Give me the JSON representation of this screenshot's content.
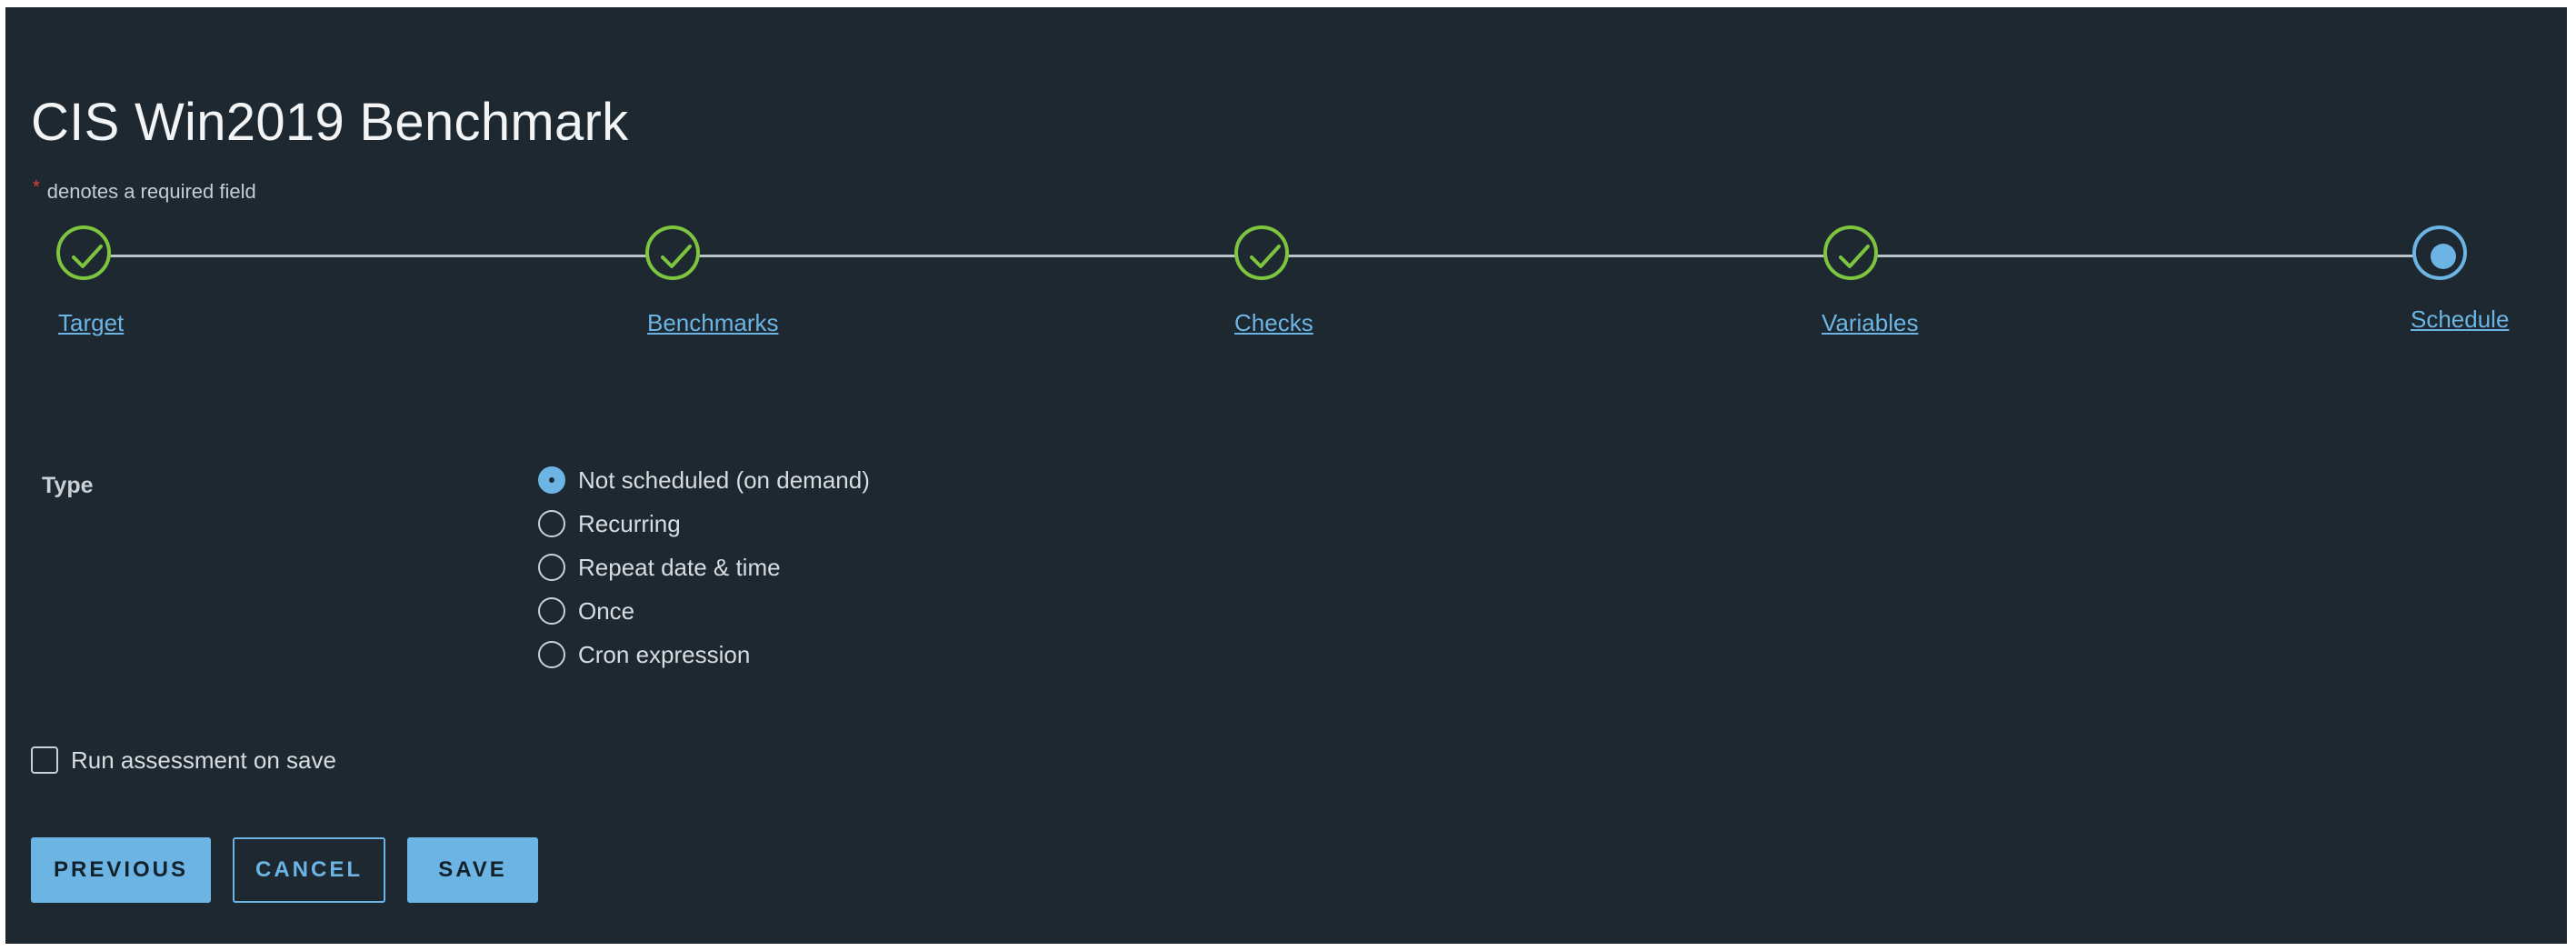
{
  "header": {
    "title": "CIS Win2019 Benchmark",
    "required_marker": "*",
    "required_note": "denotes a required field"
  },
  "stepper": {
    "steps": [
      {
        "label": "Target",
        "status": "done",
        "icon": "check-icon"
      },
      {
        "label": "Benchmarks",
        "status": "done",
        "icon": "check-icon"
      },
      {
        "label": "Checks",
        "status": "done",
        "icon": "check-icon"
      },
      {
        "label": "Variables",
        "status": "done",
        "icon": "check-icon"
      },
      {
        "label": "Schedule",
        "status": "current",
        "icon": "current-step-dot-icon"
      }
    ],
    "colors": {
      "done": "#7dc43f",
      "current": "#6cb4e4",
      "line": "#b9c4ca"
    }
  },
  "form": {
    "type_label": "Type",
    "type_options": [
      {
        "label": "Not scheduled (on demand)",
        "selected": true
      },
      {
        "label": "Recurring",
        "selected": false
      },
      {
        "label": "Repeat date & time",
        "selected": false
      },
      {
        "label": "Once",
        "selected": false
      },
      {
        "label": "Cron expression",
        "selected": false
      }
    ],
    "run_on_save_label": "Run assessment on save",
    "run_on_save_checked": false
  },
  "buttons": {
    "previous": "PREVIOUS",
    "cancel": "CANCEL",
    "save": "SAVE"
  },
  "theme": {
    "background": "#1d2830",
    "accent": "#6cb4e4",
    "success": "#7dc43f",
    "required": "#e0433a"
  }
}
